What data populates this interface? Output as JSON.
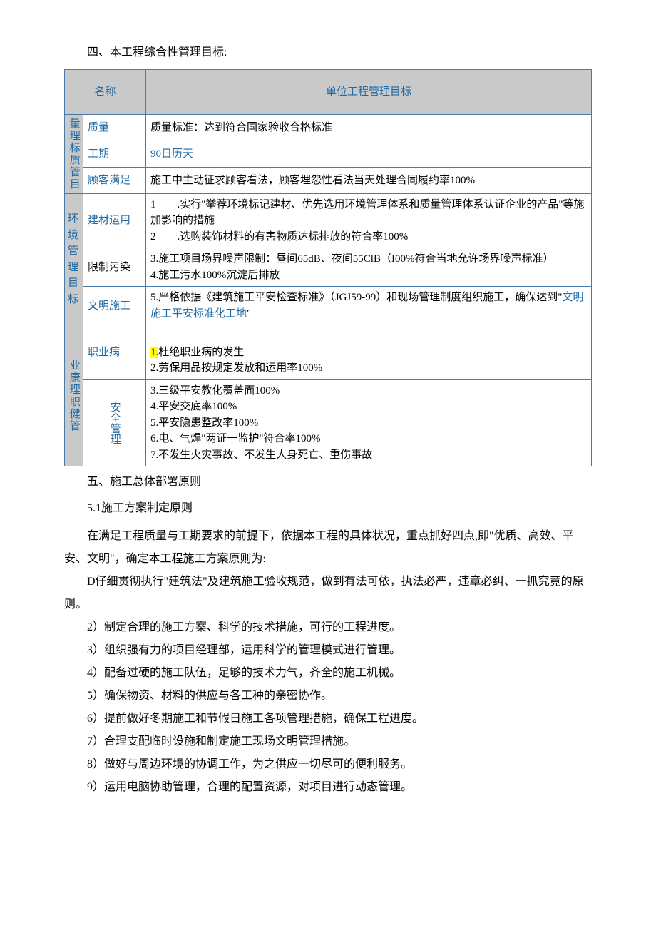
{
  "heading4": "四、本工程综合性管理目标:",
  "table": {
    "header_name": "名称",
    "header_target": "单位工程管理目标",
    "groups": [
      {
        "label": "量理标质管目",
        "rows": [
          {
            "sub": "质量",
            "content": "质量标准：达到符合国家验收合格标准"
          },
          {
            "sub": "工期",
            "content": "90日历天",
            "content_blue": true
          },
          {
            "sub": "顾客满足",
            "content": "施工中主动征求顾客看法，顾客埋怨性看法当天处理合同履约率100%"
          }
        ]
      },
      {
        "label": "环境管理目标",
        "rows": [
          {
            "sub": "建材运用",
            "content": "1　　.实行\"举荐环境标记建材、优先选用环境管理体系和质量管理体系认证企业的产品\"等施加影响的措施\n2　　.选购装饰材料的有害物质达标排放的符合率100%"
          },
          {
            "sub": "限制污染",
            "content": "3.施工项目场界噪声限制：昼间65dB、夜间55ClB（I00%符合当地允许场界噪声标准）\n4.施工污水100%沉淀后排放"
          },
          {
            "sub": "文明施工",
            "content_pre": "5.严格依据《建筑施工平安检查标准》（JGJ59-99）和现场管理制度组织施工，确保达到\"",
            "content_linked": "文明施工平安标准化工地",
            "content_post": "\""
          }
        ]
      },
      {
        "label": "业康理职健管",
        "rows": [
          {
            "sub": "职业病",
            "content_hl_prefix": "1.",
            "content_hl_rest": "杜绝职业病的发生\n2.劳保用品按规定发放和运用率100%"
          },
          {
            "sub": "安全管理",
            "sub_vertical": true,
            "content": "3.三级平安教化覆盖面100%\n4.平安交底率100%\n5.平安隐患整改率100%\n6.电、气焊\"两证一监护\"符合率100%\n7.不发生火灾事故、不发生人身死亡、重伤事故"
          }
        ]
      }
    ]
  },
  "heading5": "五、施工总体部署原则",
  "section51_title": "5.1施工方案制定原则",
  "paragraphs": [
    "在满足工程质量与工期要求的前提下，依据本工程的具体状况，重点抓好四点,即\"优质、高效、平安、文明\"，确定本工程施工方案原则为:",
    "D仔细贯彻执行\"建筑法\"及建筑施工验收规范，做到有法可依，执法必严，违章必纠、一抓究竟的原则。",
    "2）制定合理的施工方案、科学的技术措施，可行的工程进度。",
    "3）组织强有力的项目经理部，运用科学的管理模式进行管理。",
    "4）配备过硬的施工队伍，足够的技术力气，齐全的施工机械。",
    "5）确保物资、材料的供应与各工种的亲密协作。",
    "6）提前做好冬期施工和节假日施工各项管理措施，确保工程进度。",
    "7）合理支配临时设施和制定施工现场文明管理措施。",
    "8）做好与周边环境的协调工作，为之供应一切尽可的便利服务。",
    "9）运用电脑协助管理，合理的配置资源，对项目进行动态管理。"
  ]
}
